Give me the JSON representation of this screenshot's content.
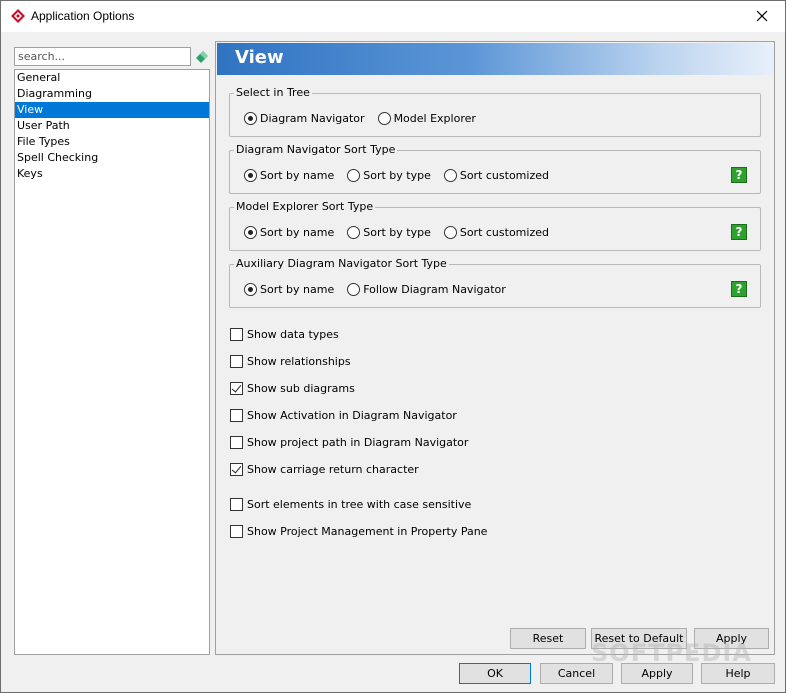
{
  "window": {
    "title": "Application Options"
  },
  "search": {
    "placeholder": "search..."
  },
  "tree": {
    "items": [
      {
        "label": "General",
        "selected": false
      },
      {
        "label": "Diagramming",
        "selected": false
      },
      {
        "label": "View",
        "selected": true
      },
      {
        "label": "User Path",
        "selected": false
      },
      {
        "label": "File Types",
        "selected": false
      },
      {
        "label": "Spell Checking",
        "selected": false
      },
      {
        "label": "Keys",
        "selected": false
      }
    ]
  },
  "view": {
    "header": "View",
    "select_in_tree": {
      "label": "Select in Tree",
      "options": [
        {
          "label": "Diagram Navigator",
          "checked": true
        },
        {
          "label": "Model Explorer",
          "checked": false
        }
      ]
    },
    "diagram_nav_sort": {
      "label": "Diagram Navigator Sort Type",
      "options": [
        {
          "label": "Sort by name",
          "checked": true
        },
        {
          "label": "Sort by type",
          "checked": false
        },
        {
          "label": "Sort customized",
          "checked": false
        }
      ],
      "help": "?"
    },
    "model_explorer_sort": {
      "label": "Model Explorer Sort Type",
      "options": [
        {
          "label": "Sort by name",
          "checked": true
        },
        {
          "label": "Sort by type",
          "checked": false
        },
        {
          "label": "Sort customized",
          "checked": false
        }
      ],
      "help": "?"
    },
    "aux_nav_sort": {
      "label": "Auxiliary Diagram Navigator Sort Type",
      "options": [
        {
          "label": "Sort by name",
          "checked": true
        },
        {
          "label": "Follow Diagram Navigator",
          "checked": false
        }
      ],
      "help": "?"
    },
    "checkboxes": [
      {
        "label": "Show data types",
        "checked": false
      },
      {
        "label": "Show relationships",
        "checked": false
      },
      {
        "label": "Show sub diagrams",
        "checked": true
      },
      {
        "label": "Show Activation in Diagram Navigator",
        "checked": false
      },
      {
        "label": "Show project path in Diagram Navigator",
        "checked": false
      },
      {
        "label": "Show carriage return character",
        "checked": true
      },
      {
        "label": "Sort elements in tree with case sensitive",
        "checked": false
      },
      {
        "label": "Show Project Management in Property Pane",
        "checked": false
      }
    ],
    "buttons": {
      "reset": "Reset",
      "reset_default": "Reset to Default",
      "apply": "Apply"
    }
  },
  "footer": {
    "ok": "OK",
    "cancel": "Cancel",
    "apply": "Apply",
    "help": "Help"
  },
  "watermark": "SOFTPEDIA",
  "colors": {
    "selection": "#0078d7",
    "header_start": "#2f73c2",
    "help_green": "#2ea12e",
    "app_icon": "#c8102e"
  }
}
